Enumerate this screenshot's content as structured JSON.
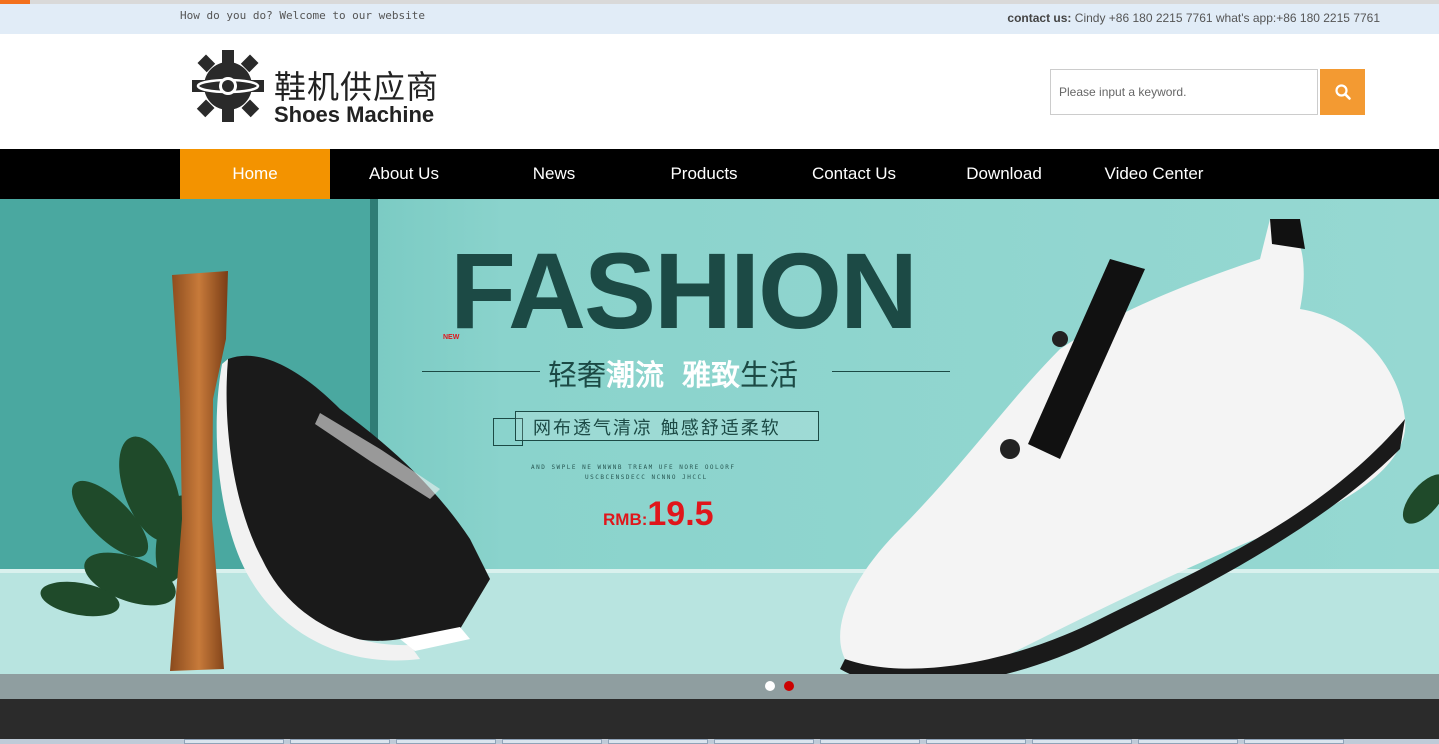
{
  "topbar": {
    "welcome": "How do you do? Welcome to our website",
    "contact_label": "contact us:",
    "contact_value": " Cindy +86 180 2215 7761  what's app:+86 180 2215 7761"
  },
  "header": {
    "logo_cn": "鞋机供应商",
    "logo_en": "Shoes Machine",
    "search": {
      "placeholder": "Please input a keyword.",
      "value": ""
    }
  },
  "nav": {
    "items": [
      {
        "label": "Home"
      },
      {
        "label": "About Us"
      },
      {
        "label": "News"
      },
      {
        "label": "Products"
      },
      {
        "label": "Contact Us"
      },
      {
        "label": "Download"
      },
      {
        "label": "Video Center"
      }
    ],
    "active": "Home"
  },
  "banner": {
    "title": "FASHION",
    "new_tag": "NEW",
    "slogan_a": "轻奢",
    "slogan_b": "潮流",
    "slogan_c": "雅致",
    "slogan_d": "生活",
    "subtitle": "网布透气清凉  触感舒适柔软",
    "tiny_line1": "AND SWPLE NE WNWNB TREAM UFE NORE OOLORF",
    "tiny_line2": "USCBCENSDECC NCNNO JHCCL",
    "price_currency": "RMB:",
    "price_value": "19.5",
    "slide_count": 2,
    "active_slide": 2
  },
  "colors": {
    "accent": "#f39300",
    "nav_bg": "#000000",
    "banner_bg": "#8fd3cc",
    "title_color": "#1c4a45",
    "price_color": "#e0161b"
  }
}
